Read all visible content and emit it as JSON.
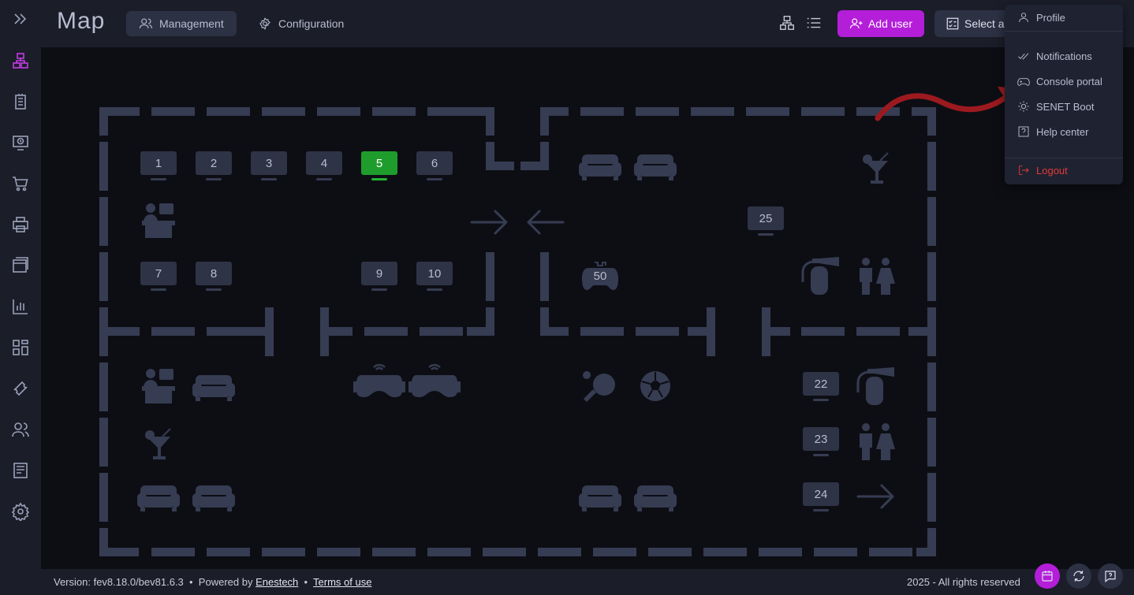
{
  "header": {
    "title": "Map",
    "tabs": [
      {
        "label": "Management",
        "icon": "users-icon",
        "active": true
      },
      {
        "label": "Configuration",
        "icon": "gear-icon",
        "active": false
      }
    ],
    "add_user_label": "Add user",
    "select_all_label": "Select all"
  },
  "menu": {
    "items": [
      {
        "label": "Profile",
        "icon": "user-icon"
      },
      {
        "label": "Notifications",
        "icon": "double-check-icon"
      },
      {
        "label": "Console portal",
        "icon": "gamepad-icon"
      },
      {
        "label": "SENET Boot",
        "icon": "boot-gear-icon"
      },
      {
        "label": "Help center",
        "icon": "question-icon"
      },
      {
        "label": "Logout",
        "icon": "logout-icon"
      }
    ]
  },
  "map": {
    "pcs": [
      "1",
      "2",
      "3",
      "4",
      "5",
      "6",
      "7",
      "8",
      "9",
      "10",
      "25",
      "22",
      "23",
      "24"
    ],
    "active_pc": "5",
    "console_label": "50"
  },
  "footer": {
    "version": "Version: fev8.18.0/bev81.6.3",
    "powered_by": "Powered by",
    "company": "Enestech",
    "terms": "Terms of use",
    "rights": "2025 - All rights reserved"
  },
  "colors": {
    "accent": "#b41ed9",
    "active_pc": "#1f9d2c",
    "logout": "#e23a3a",
    "wall": "#363c52"
  }
}
